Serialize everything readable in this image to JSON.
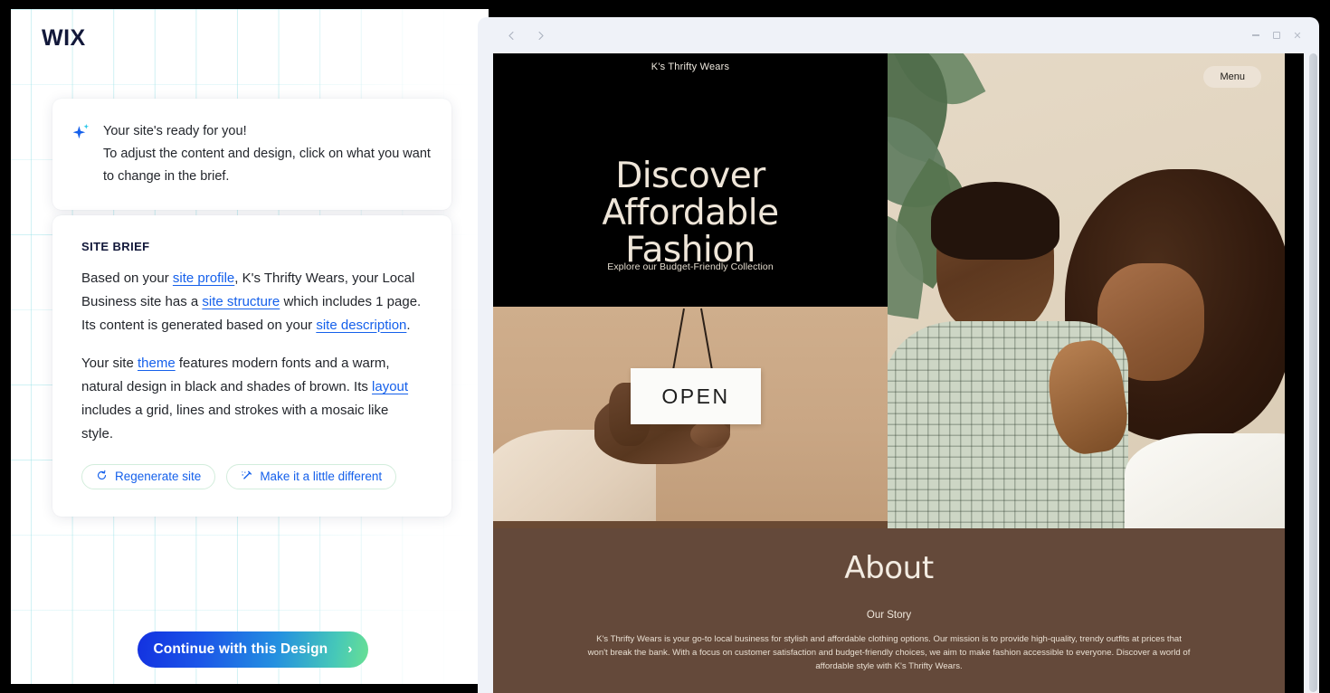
{
  "brand": {
    "logo": "WIX"
  },
  "ready_card": {
    "icon": "sparkle-icon",
    "line1": "Your site's ready for you!",
    "line2": "To adjust the content and design, click on what you want to change in the brief."
  },
  "brief": {
    "title": "SITE BRIEF",
    "paragraph1": {
      "t1": "Based on your ",
      "link1": "site profile",
      "t2": ", K's Thrifty Wears, your Local Business site has a ",
      "link2": "site structure",
      "t3": " which includes 1 page. Its content is generated based on your ",
      "link3": "site description",
      "t4": "."
    },
    "paragraph2": {
      "t1": "Your site ",
      "link1": "theme",
      "t2": " features modern fonts and a warm, natural design in black and shades of brown. Its ",
      "link2": "layout",
      "t3": " includes a grid, lines and strokes with a mosaic like style."
    },
    "actions": [
      {
        "label": "Regenerate site",
        "icon": "refresh-icon"
      },
      {
        "label": "Make it a little different",
        "icon": "magic-wand-icon"
      }
    ]
  },
  "cta": {
    "label": "Continue with this Design",
    "chevron": "›"
  },
  "browser": {
    "back_icon": "chevron-left-icon",
    "forward_icon": "chevron-right-icon",
    "minimize": "minimize-icon",
    "maximize": "maximize-icon",
    "close": "✕"
  },
  "site": {
    "title": "K's Thrifty Wears",
    "menu_label": "Menu",
    "hero": {
      "heading_line1": "Discover",
      "heading_line2": "Affordable",
      "heading_line3": "Fashion",
      "subtitle": "Explore our Budget-Friendly Collection",
      "sign_text": "OPEN"
    },
    "about": {
      "title": "About",
      "subtitle": "Our Story",
      "body": "K's Thrifty Wears is your go-to local business for stylish and affordable clothing options. Our mission is to provide high-quality, trendy outfits at prices that won't break the bank. With a focus on customer satisfaction and budget-friendly choices, we aim to make fashion accessible to everyone. Discover a world of affordable style with K's Thrifty Wears."
    }
  },
  "colors": {
    "accent_blue": "#1560eb",
    "brand_dark": "#12183a",
    "about_brown": "#64493a",
    "hero_black": "#000000",
    "sign_tan": "#c9a684",
    "cream": "#efe6d9"
  }
}
